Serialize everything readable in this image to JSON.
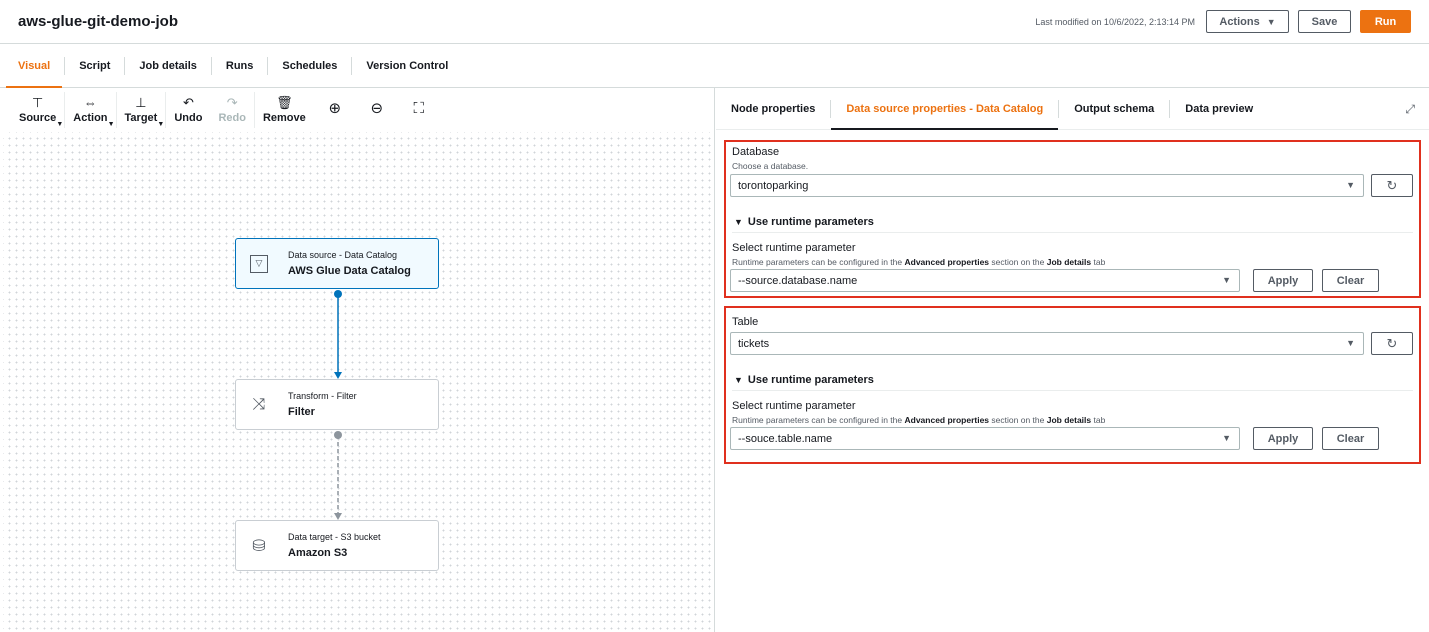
{
  "header": {
    "job_title": "aws-glue-git-demo-job",
    "last_modified": "Last modified on 10/6/2022, 2:13:14 PM",
    "actions_label": "Actions",
    "save_label": "Save",
    "run_label": "Run",
    "run_color": "#ec7211"
  },
  "tabs": [
    {
      "label": "Visual",
      "active": true
    },
    {
      "label": "Script"
    },
    {
      "label": "Job details"
    },
    {
      "label": "Runs"
    },
    {
      "label": "Schedules"
    },
    {
      "label": "Version Control"
    }
  ],
  "toolbar": {
    "source": "Source",
    "action": "Action",
    "target": "Target",
    "undo": "Undo",
    "redo": "Redo",
    "remove": "Remove"
  },
  "nodes": [
    {
      "subtitle": "Data source - Data Catalog",
      "title": "AWS Glue Data Catalog",
      "icon": "data-catalog-icon"
    },
    {
      "subtitle": "Transform - Filter",
      "title": "Filter",
      "icon": "shuffle-icon"
    },
    {
      "subtitle": "Data target - S3 bucket",
      "title": "Amazon S3",
      "icon": "bucket-icon"
    }
  ],
  "right_tabs": [
    {
      "label": "Node properties"
    },
    {
      "label": "Data source properties - Data Catalog",
      "active": true
    },
    {
      "label": "Output schema"
    },
    {
      "label": "Data preview"
    }
  ],
  "database": {
    "label": "Database",
    "description": "Choose a database.",
    "value": "torontoparking",
    "runtime_toggle": "Use runtime parameters",
    "param_label": "Select runtime parameter",
    "param_desc_prefix": "Runtime parameters can be configured in the",
    "param_desc_bold1": "Advanced properties",
    "param_desc_mid": "section on the",
    "param_desc_bold2": "Job details",
    "param_desc_suffix": "tab",
    "param_value": "--source.database.name",
    "apply_label": "Apply",
    "clear_label": "Clear"
  },
  "table": {
    "label": "Table",
    "value": "tickets",
    "runtime_toggle": "Use runtime parameters",
    "param_label": "Select runtime parameter",
    "param_desc_prefix": "Runtime parameters can be configured in the",
    "param_desc_bold1": "Advanced properties",
    "param_desc_mid": "section on the",
    "param_desc_bold2": "Job details",
    "param_desc_suffix": "tab",
    "param_value": "--souce.table.name",
    "apply_label": "Apply",
    "clear_label": "Clear"
  },
  "highlight_color": "#e0301e",
  "edge_color": "#0073bb"
}
